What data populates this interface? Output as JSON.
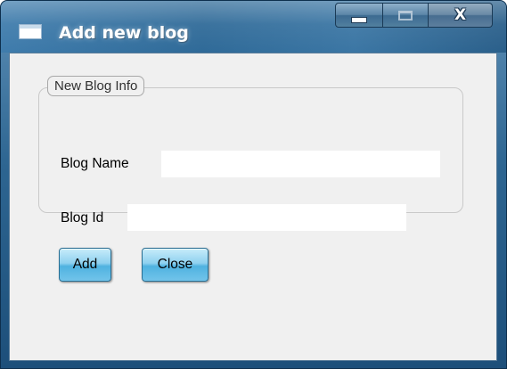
{
  "window": {
    "title": "Add new blog",
    "controls": {
      "minimize": "minimize",
      "maximize": "maximize",
      "close": "X"
    }
  },
  "group": {
    "legend": "New Blog Info",
    "fields": {
      "blog_name": {
        "label": "Blog Name",
        "value": "",
        "placeholder": ""
      },
      "blog_id": {
        "label": "Blog Id",
        "value": "",
        "placeholder": ""
      }
    }
  },
  "actions": {
    "add_label": "Add",
    "close_label": "Close"
  },
  "colors": {
    "title_bar": "#2f6a98",
    "client_background": "#f0f0f0",
    "button_accent": "#4fb2e0"
  },
  "icons": [
    "window-app-icon",
    "minimize-icon",
    "maximize-icon",
    "close-icon"
  ]
}
